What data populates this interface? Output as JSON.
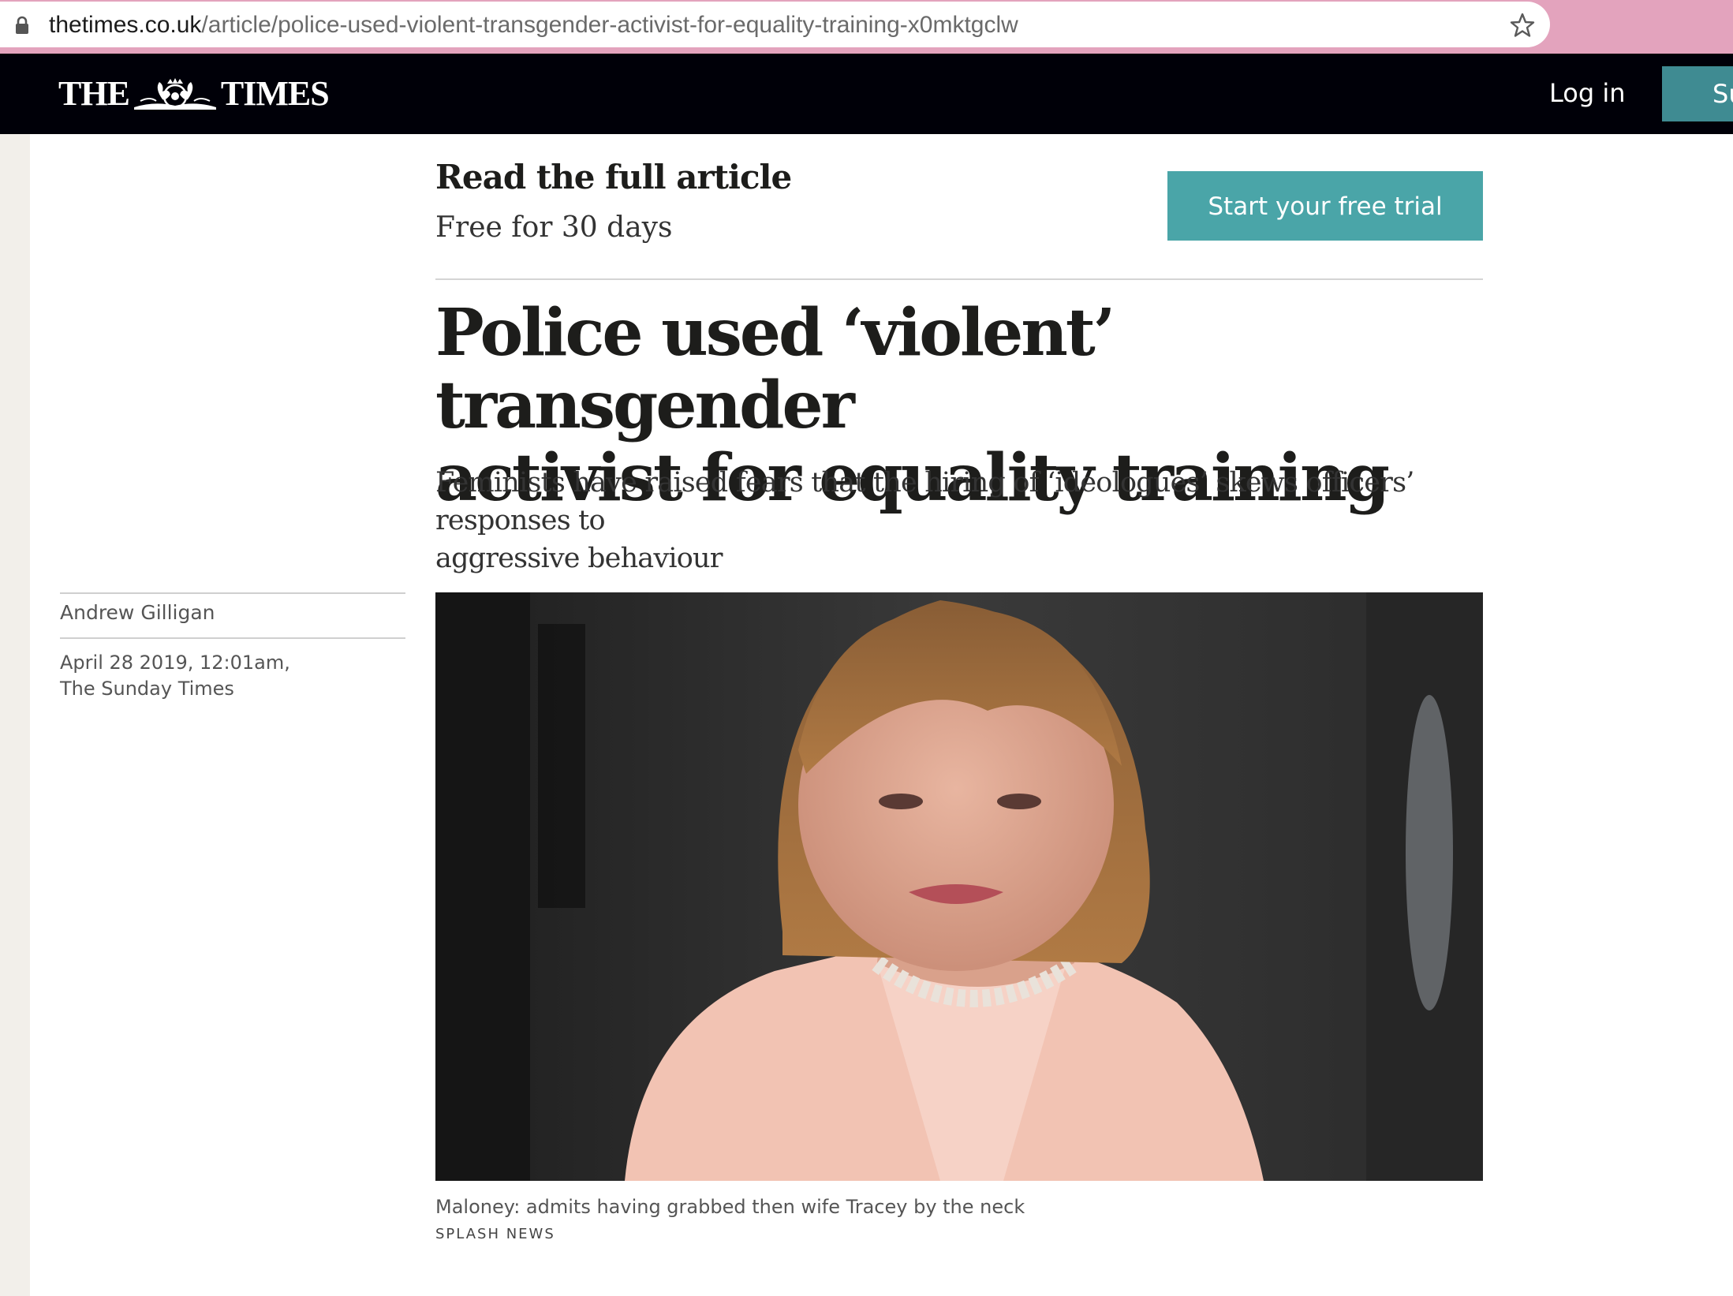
{
  "browser": {
    "url_domain": "thetimes.co.uk",
    "url_path": "/article/police-used-violent-transgender-activist-for-equality-training-x0mktgclw",
    "lock_icon": "lock-icon",
    "star_icon": "star-icon"
  },
  "header": {
    "logo_left": "THE",
    "logo_right": "TIMES",
    "login_label": "Log in",
    "subscribe_label": "Su",
    "background": "#000008",
    "accent": "#3f8b92"
  },
  "promo": {
    "title": "Read the full article",
    "subtitle": "Free for 30 days",
    "button_label": "Start your free trial",
    "button_color": "#4aa5a8"
  },
  "article": {
    "headline_line1": "Police used ‘violent’ transgender",
    "headline_line2": "activist for equality training",
    "standfirst_line1": "Feminists have raised fears that the hiring of ‘ideologues’ skews officers’ responses to",
    "standfirst_line2": "aggressive behaviour",
    "author": "Andrew Gilligan",
    "date": "April 28 2019, 12:01am,",
    "publication": "The Sunday Times",
    "photo_caption": "Maloney: admits having grabbed then wife Tracey by the neck",
    "photo_credit": "SPLASH NEWS"
  }
}
